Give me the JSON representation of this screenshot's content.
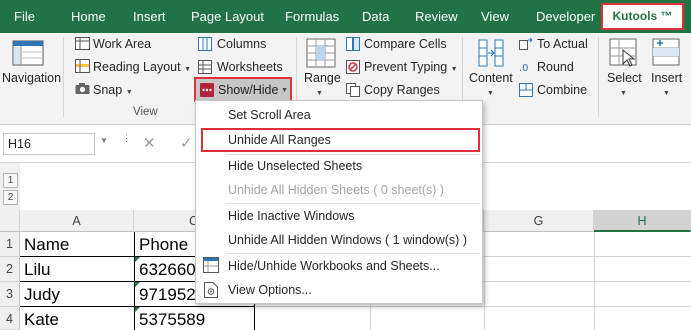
{
  "ribbon_tabs": [
    "File",
    "Home",
    "Insert",
    "Page Layout",
    "Formulas",
    "Data",
    "Review",
    "View",
    "Developer",
    "Kutools ™"
  ],
  "ribbon": {
    "navigation": "Navigation",
    "work_area": "Work Area",
    "reading_layout": "Reading Layout",
    "snap": "Snap",
    "columns": "Columns",
    "worksheets": "Worksheets",
    "show_hide": "Show/Hide",
    "group_view": "View",
    "range": "Range",
    "compare_cells": "Compare Cells",
    "prevent_typing": "Prevent Typing",
    "copy_ranges": "Copy Ranges",
    "content": "Content",
    "to_actual": "To Actual",
    "round": "Round",
    "combine": "Combine",
    "select": "Select",
    "insert": "Insert"
  },
  "formula_bar": {
    "name_box": "H16",
    "cancel": "✕",
    "confirm": "✓"
  },
  "outline_levels": [
    "1",
    "2"
  ],
  "columns": [
    "A",
    "G",
    "H"
  ],
  "column_c_partial": "C",
  "rows": [
    {
      "num": "1",
      "a": "Name",
      "c": "Phone"
    },
    {
      "num": "2",
      "a": "Lilu",
      "c": "632660"
    },
    {
      "num": "3",
      "a": "Judy",
      "c": "971952"
    },
    {
      "num": "4",
      "a": "Kate",
      "c": "5375589"
    }
  ],
  "menu": {
    "set_scroll_area": "Set Scroll Area",
    "unhide_all_ranges": "Unhide All Ranges",
    "hide_unselected_sheets": "Hide Unselected Sheets",
    "unhide_all_hidden_sheets": "Unhide All Hidden Sheets ( 0 sheet(s) )",
    "hide_inactive_windows": "Hide Inactive Windows",
    "unhide_all_hidden_windows": "Unhide All Hidden Windows ( 1 window(s) )",
    "hide_unhide_workbooks": "Hide/Unhide Workbooks and Sheets...",
    "view_options": "View Options..."
  },
  "colors": {
    "ribbon_green": "#217346",
    "highlight_red": "#e0313b",
    "show_hide_icon": "#b4233c"
  }
}
